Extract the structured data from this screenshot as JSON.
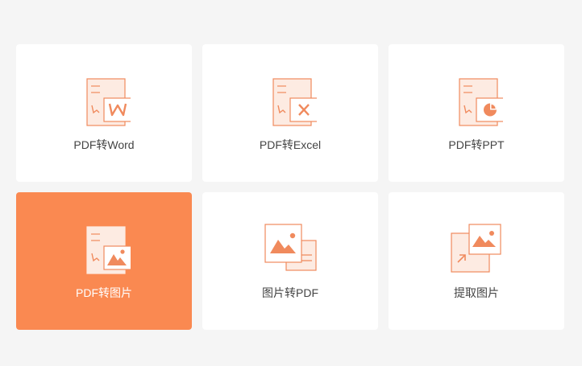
{
  "colors": {
    "background": "#f5f5f5",
    "card": "#ffffff",
    "active_card": "#fa8951",
    "icon_stroke": "#f08a5d",
    "icon_fill": "#fdebe2",
    "label": "#444444",
    "active_label": "#ffffff"
  },
  "tools": [
    {
      "label": "PDF转Word",
      "icon": "pdf-to-word-icon",
      "active": false
    },
    {
      "label": "PDF转Excel",
      "icon": "pdf-to-excel-icon",
      "active": false
    },
    {
      "label": "PDF转PPT",
      "icon": "pdf-to-ppt-icon",
      "active": false
    },
    {
      "label": "PDF转图片",
      "icon": "pdf-to-image-icon",
      "active": true
    },
    {
      "label": "图片转PDF",
      "icon": "image-to-pdf-icon",
      "active": false
    },
    {
      "label": "提取图片",
      "icon": "extract-images-icon",
      "active": false
    }
  ]
}
